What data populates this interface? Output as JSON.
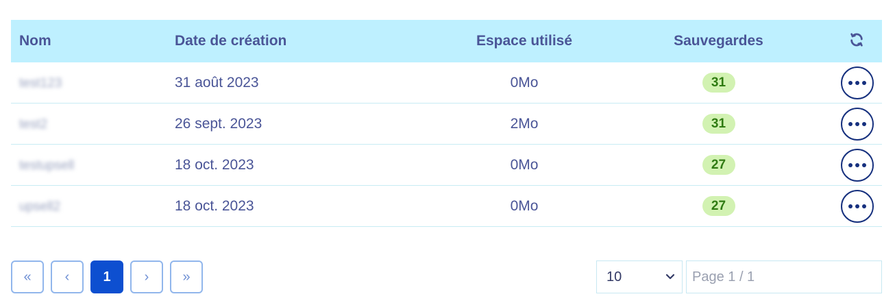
{
  "table": {
    "headers": {
      "name": "Nom",
      "date": "Date de création",
      "space": "Espace utilisé",
      "saves": "Sauvegardes",
      "refresh_icon": "refresh-icon"
    },
    "rows": [
      {
        "name": "test123",
        "date": "31 août 2023",
        "space": "0Mo",
        "saves": "31"
      },
      {
        "name": "test2",
        "date": "26 sept. 2023",
        "space": "2Mo",
        "saves": "31"
      },
      {
        "name": "testupsell",
        "date": "18 oct. 2023",
        "space": "0Mo",
        "saves": "27"
      },
      {
        "name": "upsell2",
        "date": "18 oct. 2023",
        "space": "0Mo",
        "saves": "27"
      }
    ],
    "row_action_icon": "more-options-icon"
  },
  "pagination": {
    "first": "«",
    "prev": "‹",
    "current": "1",
    "next": "›",
    "last": "»",
    "page_size": "10",
    "page_info": "Page 1 / 1"
  },
  "colors": {
    "header_bg": "#bef0ff",
    "text": "#4a5597",
    "badge_bg": "#d2f2b2",
    "badge_text": "#2f7b12",
    "primary": "#0d4fd0"
  }
}
